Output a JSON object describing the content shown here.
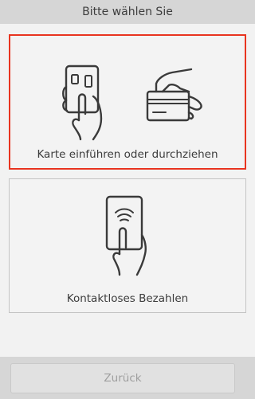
{
  "header": {
    "title": "Bitte wählen Sie"
  },
  "options": {
    "card": {
      "label": "Karte einführen oder durchziehen",
      "selected": true,
      "icons": [
        "card-insert-icon",
        "card-swipe-icon"
      ]
    },
    "contactless": {
      "label": "Kontaktloses Bezahlen",
      "selected": false,
      "icons": [
        "contactless-payment-icon"
      ]
    }
  },
  "footer": {
    "back_label": "Zurück",
    "back_enabled": false
  },
  "colors": {
    "selection_border": "#e8341f",
    "bar_background": "#d6d6d6",
    "page_background": "#f2f2f2",
    "disabled_text": "#9e9e9e"
  }
}
